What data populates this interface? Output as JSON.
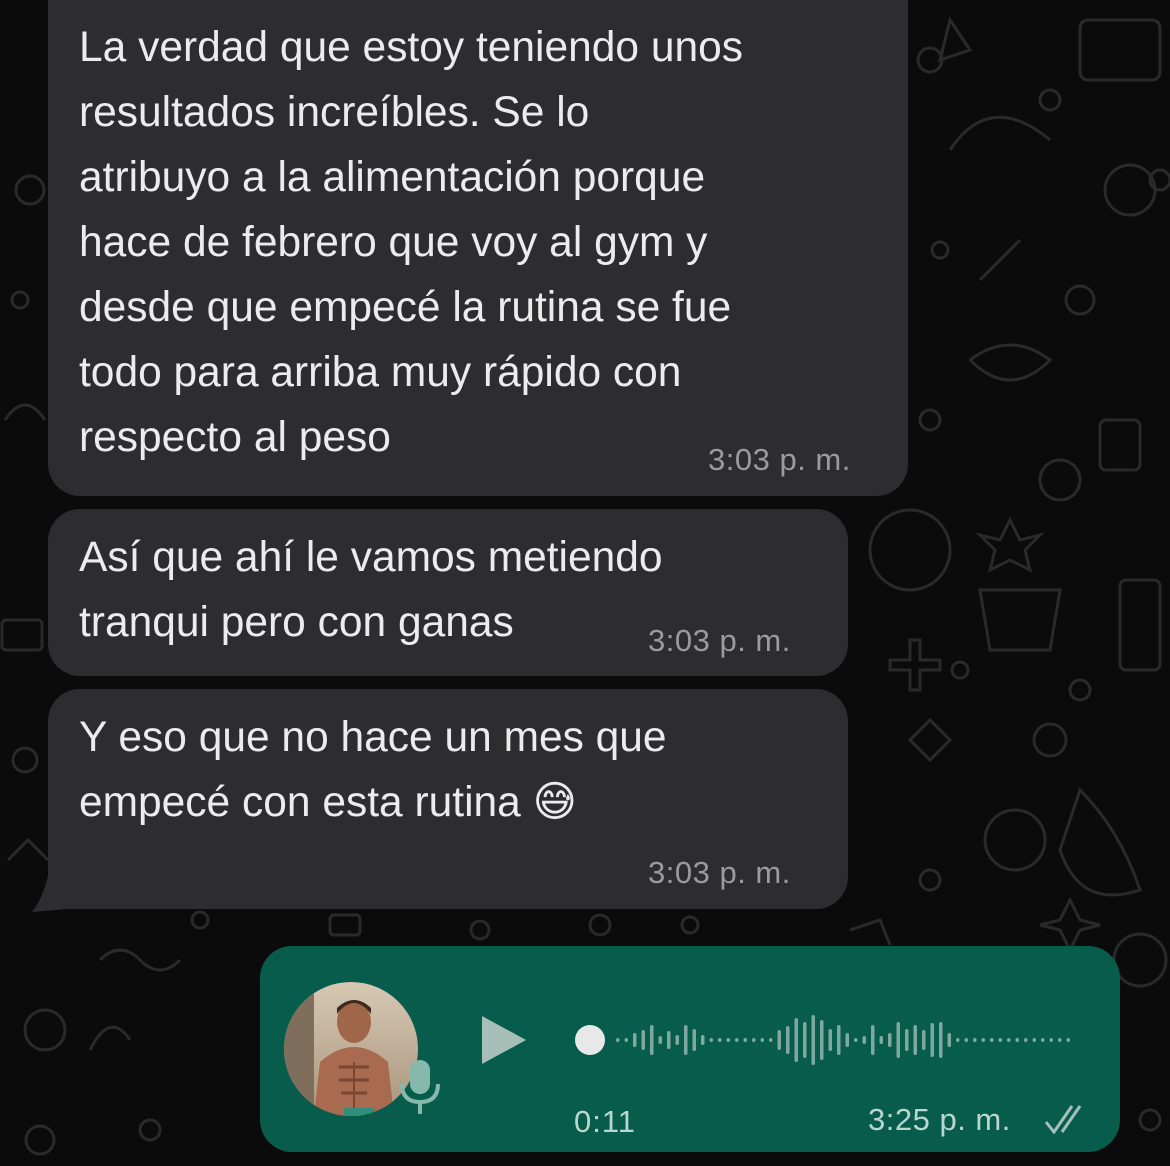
{
  "messages": [
    {
      "text": "La verdad que estoy teniendo unos\nresultados increíbles. Se lo\natribuyo a la alimentación porque\nhace de febrero que voy al gym y\ndesde que empecé la rutina se fue\ntodo para arriba muy rápido con\nrespecto al peso",
      "time": "3:03 p. m."
    },
    {
      "text": "Así que ahí le vamos metiendo\ntranqui pero con ganas",
      "time": "3:03 p. m."
    },
    {
      "text": "Y eso que no hace un mes que\nempecé con esta rutina 😅",
      "time": "3:03 p. m."
    }
  ],
  "voice_note": {
    "duration": "0:11",
    "time": "3:25 p. m.",
    "progress": 0,
    "status_icon": "double-check-icon",
    "play_icon": "play-icon",
    "mic_icon": "microphone-icon"
  },
  "colors": {
    "incoming_bubble": "#2d2d2f",
    "outgoing_bubble": "#075c4c",
    "background": "#0b0b0b"
  }
}
